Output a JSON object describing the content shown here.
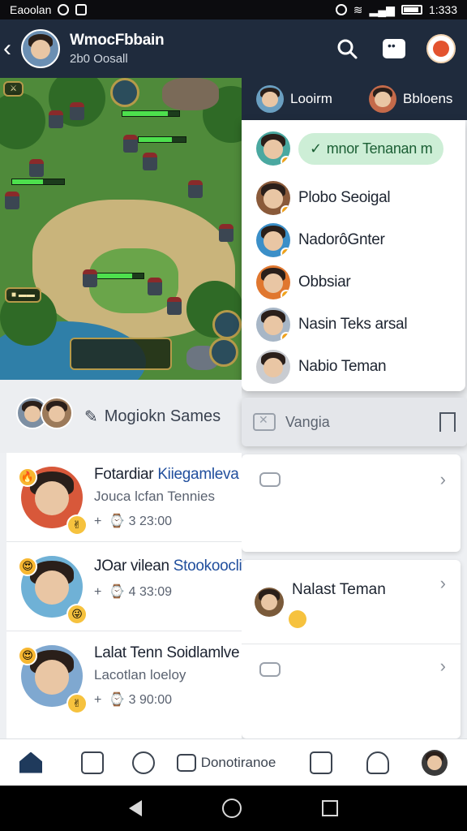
{
  "status_bar": {
    "carrier": "Eaoolan",
    "time": "1:333"
  },
  "header": {
    "title": "WmocFbbain",
    "subtitle": "2b0 Oosall"
  },
  "game_panel": {},
  "right_tabs": [
    {
      "label": "Looirm"
    },
    {
      "label": "Bbloens"
    }
  ],
  "friends_popup": {
    "highlight": "mnor Tenanan m",
    "items": [
      {
        "name": "Plobo Seoigal"
      },
      {
        "name": "NadorôGnter"
      },
      {
        "name": "Obbsiar"
      },
      {
        "name": "Nasin Teks arsal"
      },
      {
        "name": "Nabio Teman"
      }
    ]
  },
  "suggest": {
    "label": "Mogiokn Sames"
  },
  "vangia": {
    "label": "Vangia"
  },
  "right_card_item": {
    "name": "Nalast Teman"
  },
  "feed": [
    {
      "name_a": "Fotardiar ",
      "name_b": "Kiiegamleva",
      "sub": "Jouca lcfan Tennies",
      "meta": "3 23:00"
    },
    {
      "name_a": "JOar vilean ",
      "name_b": "Stookoocli",
      "sub": "",
      "meta": "4 33:09"
    },
    {
      "name_a": "Lalat Tenn Soidlamlve",
      "name_b": "",
      "sub": "Lacotlan loeloy",
      "meta": "3 90:00"
    }
  ],
  "bottom_nav": {
    "label": "Donotiranoe"
  },
  "colors": {
    "header_bg": "#1f2b3d",
    "bubble_bg": "#cdeed6",
    "bubble_text": "#1b5f34",
    "name_blue": "#214f9d"
  }
}
